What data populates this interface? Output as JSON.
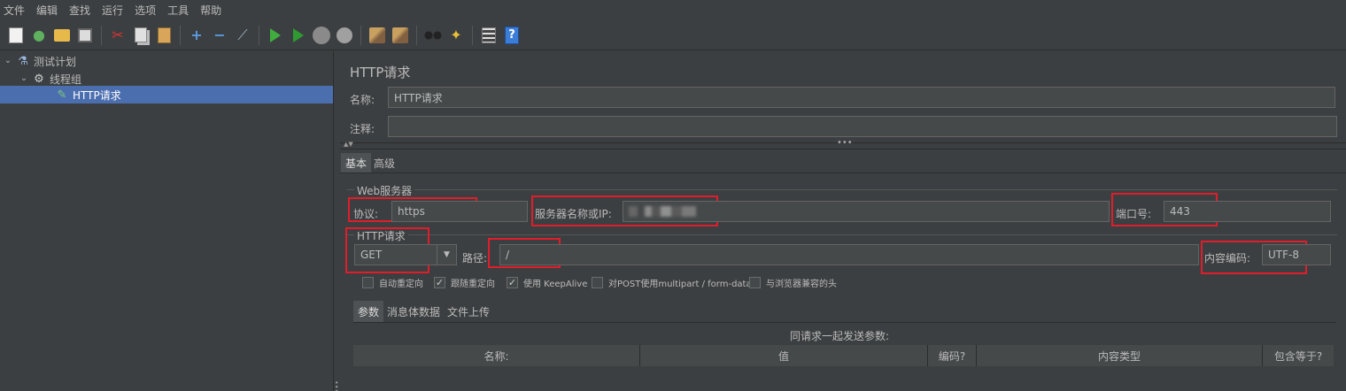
{
  "menu": [
    "文件",
    "编辑",
    "查找",
    "运行",
    "选项",
    "工具",
    "帮助"
  ],
  "toolbar_icons": [
    "new-document-icon",
    "templates-icon",
    "open-icon",
    "save-icon",
    "cut-icon",
    "copy-icon",
    "paste-icon",
    "expand-icon",
    "collapse-icon",
    "toggle-icon",
    "start-icon",
    "start-no-pause-icon",
    "stop-icon",
    "shutdown-icon",
    "clear-icon",
    "clear-all-icon",
    "search-icon",
    "reset-search-icon",
    "function-helper-icon",
    "help-icon"
  ],
  "tree": {
    "items": [
      {
        "label": "测试计划",
        "icon": "flask-icon"
      },
      {
        "label": "线程组",
        "icon": "gear-icon"
      },
      {
        "label": "HTTP请求",
        "icon": "pen-icon"
      }
    ]
  },
  "panel": {
    "title": "HTTP请求",
    "name_label": "名称:",
    "name_value": "HTTP请求",
    "comment_label": "注释:",
    "comment_value": "",
    "tabs": [
      "基本",
      "高级"
    ],
    "web_server": {
      "group_title": "Web服务器",
      "protocol_label": "协议:",
      "protocol_value": "https",
      "server_label": "服务器名称或IP:",
      "port_label": "端口号:",
      "port_value": "443"
    },
    "http_request": {
      "group_title": "HTTP请求",
      "method_value": "GET",
      "path_label": "路径:",
      "path_value": "/",
      "encoding_label": "内容编码:",
      "encoding_value": "UTF-8"
    },
    "options": [
      {
        "label": "自动重定向",
        "checked": false
      },
      {
        "label": "跟随重定向",
        "checked": true
      },
      {
        "label": "使用 KeepAlive",
        "checked": true
      },
      {
        "label": "对POST使用multipart / form-data",
        "checked": false
      },
      {
        "label": "与浏览器兼容的头",
        "checked": false
      }
    ],
    "sub_tabs": [
      "参数",
      "消息体数据",
      "文件上传"
    ],
    "params_caption": "同请求一起发送参数:",
    "table_headers": [
      "名称:",
      "值",
      "编码?",
      "内容类型",
      "包含等于?"
    ]
  },
  "colors": {
    "background": "#3c3f41",
    "selection": "#4b6eaf",
    "highlight_box": "#e01d2b",
    "field": "#45494a"
  }
}
